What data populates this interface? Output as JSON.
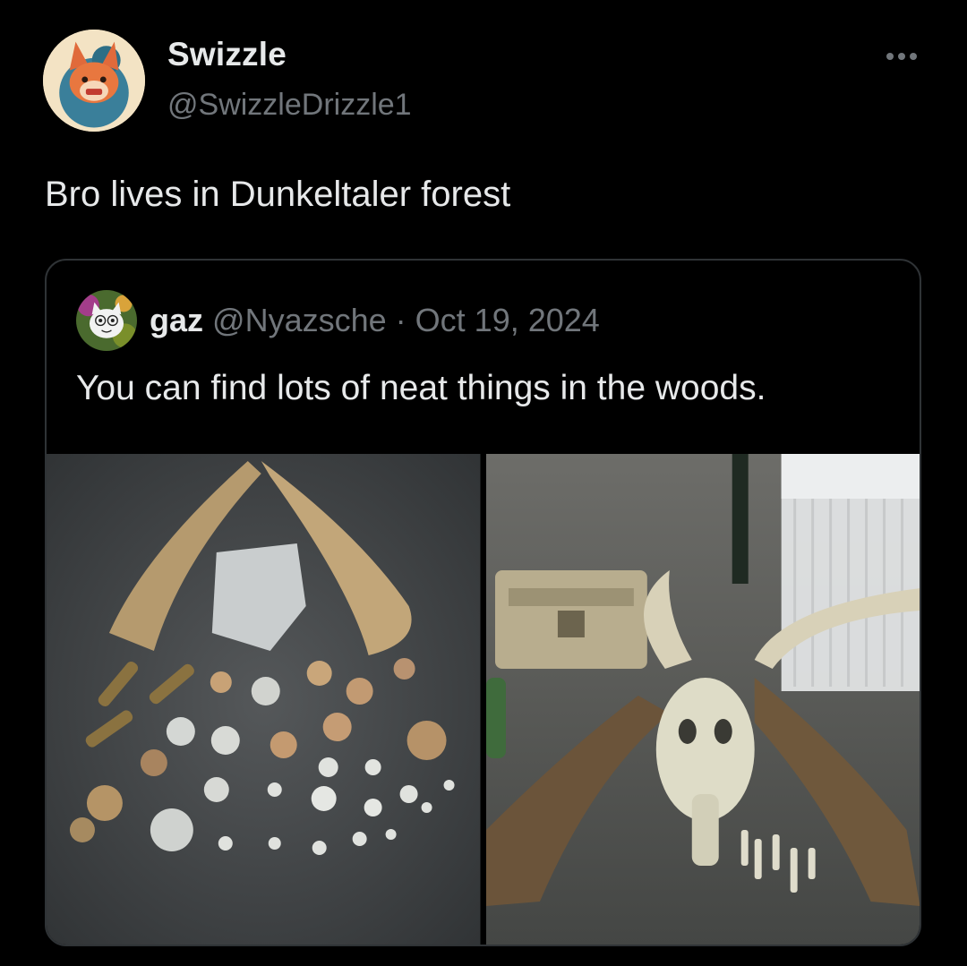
{
  "author": {
    "name": "Swizzle",
    "handle": "@SwizzleDrizzle1",
    "avatar_icon": "fox-avatar-icon"
  },
  "more_icon": "more-horizontal-icon",
  "tweet": {
    "text": "Bro lives in Dunkeltaler forest"
  },
  "quoted_tweet": {
    "name": "gaz",
    "handle": "@Nyazsche",
    "separator": "·",
    "date": "Oct 19, 2024",
    "text": "You can find lots of neat things in the woods.",
    "avatar_icon": "cat-avatar-icon",
    "media": [
      {
        "icon": "bones-and-stones-photo"
      },
      {
        "icon": "deer-skull-photo"
      }
    ]
  },
  "colors": {
    "background": "#000000",
    "text_primary": "#e7e9ea",
    "text_secondary": "#71767b",
    "border": "#2f3336"
  }
}
